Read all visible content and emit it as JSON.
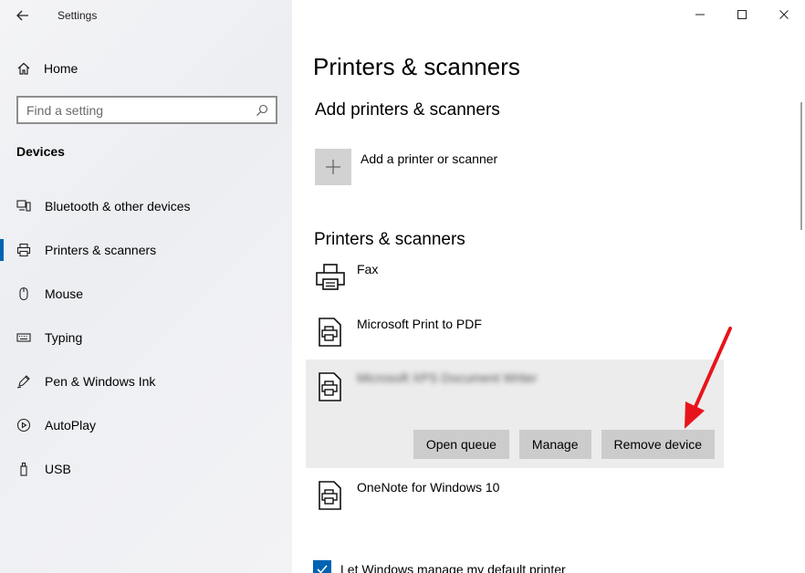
{
  "window": {
    "title": "Settings",
    "controls": [
      "minimize-icon",
      "maximize-icon",
      "close-icon"
    ]
  },
  "sidebar": {
    "home_label": "Home",
    "search": {
      "placeholder": "Find a setting",
      "value": ""
    },
    "section": "Devices",
    "items": [
      {
        "label": "Bluetooth & other devices",
        "icon": "bluetooth-devices-icon",
        "active": false
      },
      {
        "label": "Printers & scanners",
        "icon": "printer-icon",
        "active": true
      },
      {
        "label": "Mouse",
        "icon": "mouse-icon",
        "active": false
      },
      {
        "label": "Typing",
        "icon": "keyboard-icon",
        "active": false
      },
      {
        "label": "Pen & Windows Ink",
        "icon": "pen-icon",
        "active": false
      },
      {
        "label": "AutoPlay",
        "icon": "autoplay-icon",
        "active": false
      },
      {
        "label": "USB",
        "icon": "usb-icon",
        "active": false
      }
    ]
  },
  "main": {
    "title": "Printers & scanners",
    "add_section": {
      "heading": "Add printers & scanners",
      "add_label": "Add a printer or scanner"
    },
    "list_section": {
      "heading": "Printers & scanners",
      "devices": [
        {
          "name": "Fax",
          "icon": "fax-icon"
        },
        {
          "name": "Microsoft Print to PDF",
          "icon": "printer-document-icon"
        },
        {
          "name": "Microsoft XPS Document Writer",
          "icon": "printer-document-icon",
          "selected": true,
          "blurred": true
        },
        {
          "name": "OneNote for Windows 10",
          "icon": "printer-document-icon"
        }
      ],
      "actions": {
        "open_queue": "Open queue",
        "manage": "Manage",
        "remove": "Remove device"
      }
    },
    "default_printer": {
      "label": "Let Windows manage my default printer",
      "checked": true
    }
  },
  "colors": {
    "accent": "#0063b1",
    "annotation_arrow": "#e8141b"
  }
}
